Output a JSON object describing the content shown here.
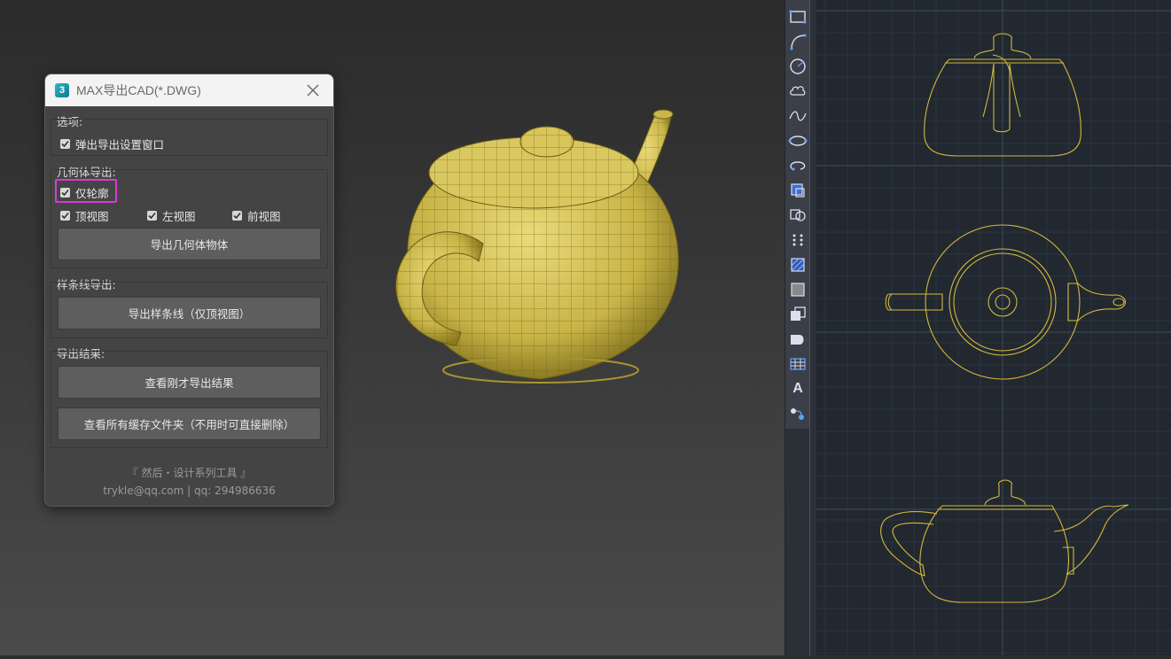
{
  "dialog": {
    "title": "MAX导出CAD(*.DWG)",
    "app_icon_glyph": "3",
    "options_group": {
      "label": "选项:",
      "popup_checkbox": "弹出导出设置窗口"
    },
    "geometry_group": {
      "label": "几何体导出:",
      "outline_only": "仅轮廓",
      "top_view": "顶视图",
      "left_view": "左视图",
      "front_view": "前视图",
      "export_button": "导出几何体物体"
    },
    "spline_group": {
      "label": "样条线导出:",
      "export_button": "导出样条线（仅顶视图）"
    },
    "result_group": {
      "label": "导出结果:",
      "view_last_button": "查看刚才导出结果",
      "view_cache_button": "查看所有缓存文件夹（不用时可直接删除）"
    },
    "footer": {
      "credit": "『 然后・设计系列工具 』",
      "contact": "trykle@qq.com | qq: 294986636"
    }
  },
  "cad_toolbar": {
    "icons": [
      "rectangle-icon",
      "arc-icon",
      "circle-icon",
      "revision-cloud-icon",
      "spline-icon",
      "ellipse-icon",
      "ellipse-arc-icon",
      "insert-block-icon",
      "create-block-icon",
      "point-icon",
      "hatch-icon",
      "gradient-icon",
      "boundary-icon",
      "region-icon",
      "wipeout-icon",
      "table-icon",
      "text-icon",
      "add-selected-icon"
    ],
    "text_glyph": "A"
  },
  "colors": {
    "teapot": "#d8c65a",
    "cad_line": "#d4b83c",
    "cad_background": "#212830",
    "highlight": "#d63ad6",
    "toolbar_icon": "#5aa0ff"
  }
}
